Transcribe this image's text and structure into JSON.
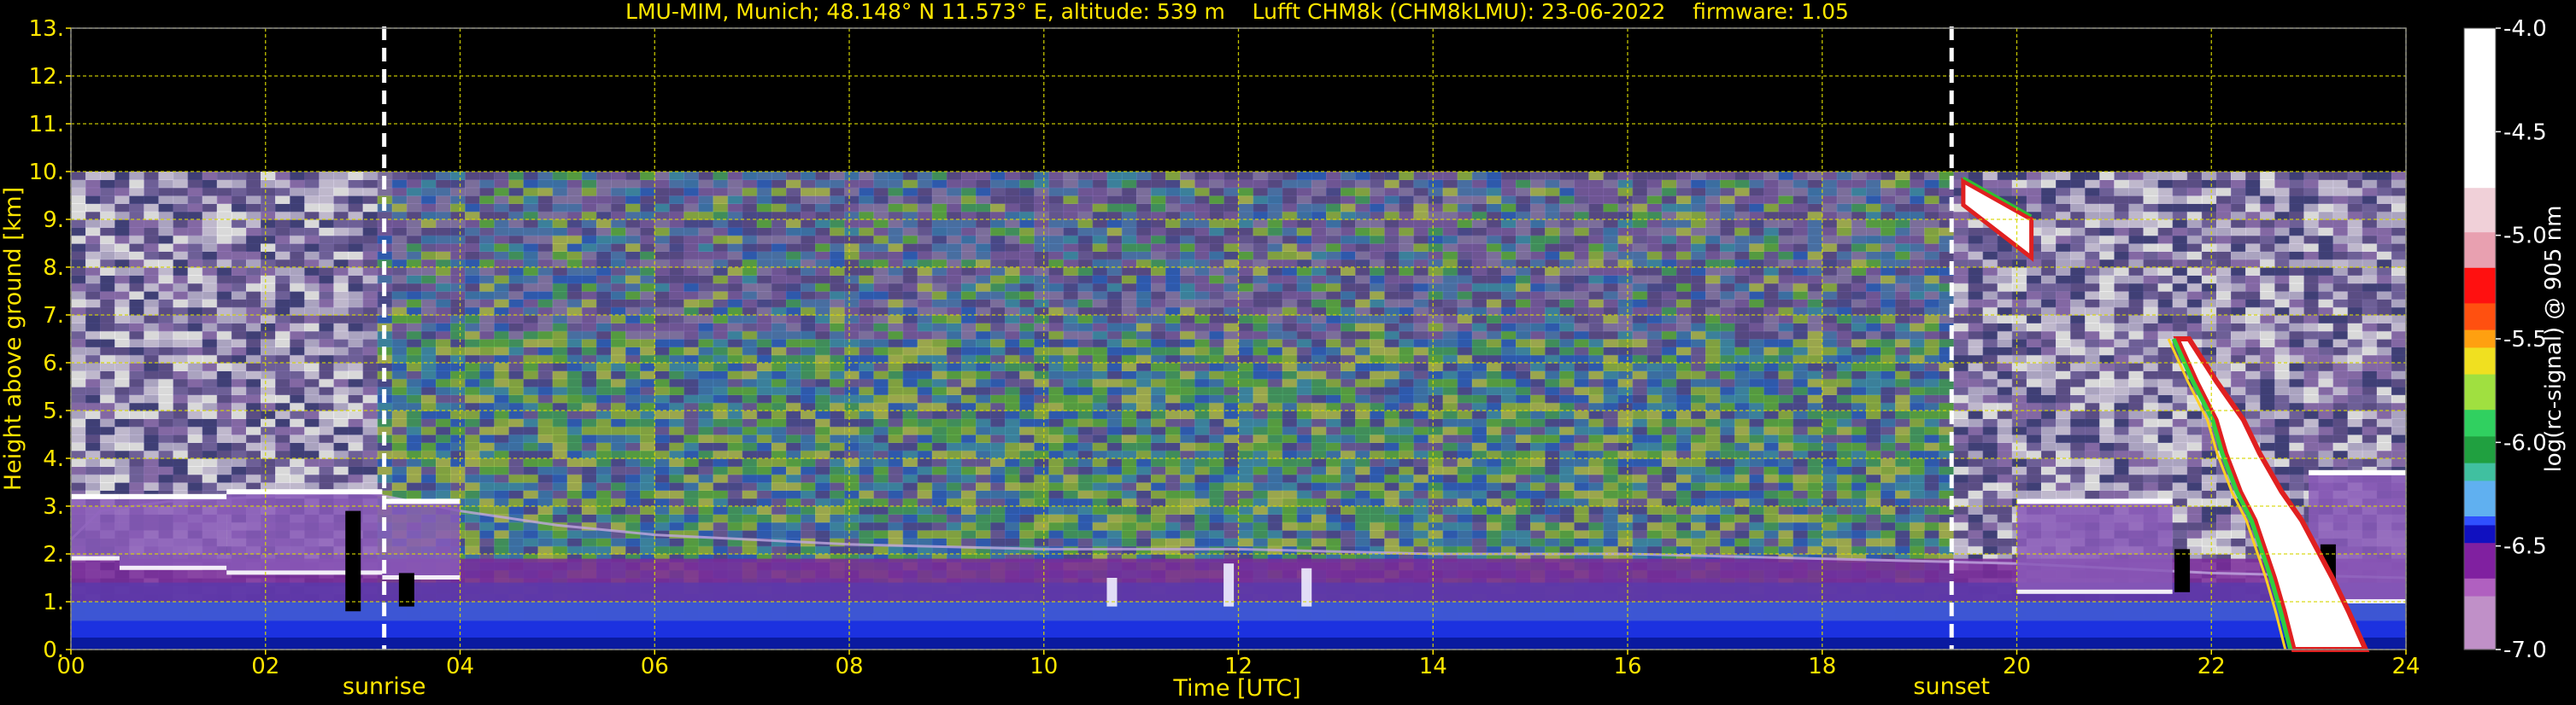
{
  "chart_data": {
    "type": "heatmap",
    "title": "LMU-MIM, Munich; 48.148° N 11.573° E, altitude: 539 m    Lufft CHM8k (CHM8kLMU): 23-06-2022    firmware: 1.05",
    "xlabel": "Time [UTC]",
    "ylabel": "Height above ground [km]",
    "xlim": [
      0,
      24
    ],
    "ylim": [
      0,
      13
    ],
    "x_ticks": [
      0,
      2,
      4,
      6,
      8,
      10,
      12,
      14,
      16,
      18,
      20,
      22,
      24
    ],
    "x_tick_labels": [
      "00",
      "02",
      "04",
      "06",
      "08",
      "10",
      "12",
      "14",
      "16",
      "18",
      "20",
      "22",
      "24"
    ],
    "y_ticks": [
      0,
      1,
      2,
      3,
      4,
      5,
      6,
      7,
      8,
      9,
      10,
      11,
      12,
      13
    ],
    "y_tick_labels": [
      "0.",
      "1.",
      "2.",
      "3.",
      "4.",
      "5.",
      "6.",
      "7.",
      "8.",
      "9.",
      "10.",
      "11.",
      "12.",
      "13."
    ],
    "grid": true,
    "data_top_km": 10,
    "sunrise": {
      "x": 3.22,
      "label": "sunrise"
    },
    "sunset": {
      "x": 19.33,
      "label": "sunset"
    },
    "colorbar": {
      "label": "log(rc-signal) @ 905 nm",
      "min": -7.0,
      "max": -4.0,
      "ticks": [
        -4.0,
        -4.5,
        -5.0,
        -5.5,
        -6.0,
        -6.5,
        -7.0
      ],
      "tick_labels": [
        "-4.0",
        "-4.5",
        "-5.0",
        "-5.5",
        "-6.0",
        "-6.5",
        "-7.0"
      ]
    },
    "features": {
      "boundary_layer_top_km": [
        [
          0.0,
          2.3
        ],
        [
          0.3,
          2.9
        ],
        [
          1.0,
          3.1
        ],
        [
          2.0,
          3.2
        ],
        [
          3.0,
          3.3
        ],
        [
          4.0,
          2.9
        ],
        [
          5.0,
          2.6
        ],
        [
          6.0,
          2.4
        ],
        [
          7.0,
          2.3
        ],
        [
          8.0,
          2.2
        ],
        [
          10.0,
          2.1
        ],
        [
          12.0,
          2.1
        ],
        [
          14.0,
          2.0
        ],
        [
          16.0,
          2.0
        ],
        [
          18.0,
          1.9
        ],
        [
          20.0,
          1.8
        ],
        [
          22.0,
          1.6
        ],
        [
          24.0,
          1.5
        ]
      ],
      "residual_layer_segments": [
        {
          "x0": 0.0,
          "x1": 0.5,
          "bottom_km": 1.9,
          "top_km": 3.2
        },
        {
          "x0": 0.5,
          "x1": 1.6,
          "bottom_km": 1.7,
          "top_km": 3.2
        },
        {
          "x0": 1.6,
          "x1": 3.2,
          "bottom_km": 1.6,
          "top_km": 3.3
        },
        {
          "x0": 3.2,
          "x1": 4.0,
          "bottom_km": 1.5,
          "top_km": 3.1
        },
        {
          "x0": 20.0,
          "x1": 21.6,
          "bottom_km": 1.2,
          "top_km": 3.1
        },
        {
          "x0": 23.0,
          "x1": 24.0,
          "bottom_km": 1.0,
          "top_km": 3.7
        }
      ],
      "convective_plumes": [
        {
          "x": 10.7,
          "top_km": 1.5
        },
        {
          "x": 11.9,
          "top_km": 1.8
        },
        {
          "x": 12.7,
          "top_km": 1.7
        }
      ],
      "high_cloud": {
        "x0": 19.45,
        "x1": 20.15,
        "top_start_km": 9.8,
        "top_end_km": 9.0,
        "base_start_km": 9.3,
        "base_end_km": 8.2
      },
      "cloud_fall_streak": [
        [
          21.7,
          6.5
        ],
        [
          21.9,
          5.6
        ],
        [
          22.1,
          4.8
        ],
        [
          22.2,
          4.1
        ],
        [
          22.35,
          3.3
        ],
        [
          22.5,
          2.7
        ],
        [
          22.6,
          2.1
        ],
        [
          22.7,
          1.5
        ],
        [
          22.8,
          0.8
        ],
        [
          22.9,
          0.0
        ]
      ],
      "night_noise_ranges": [
        [
          0.0,
          3.2
        ],
        [
          19.33,
          24.0
        ]
      ],
      "clear_gap_columns": [
        {
          "x": 2.9,
          "bottom_km": 0.8,
          "top_km": 2.9
        },
        {
          "x": 3.45,
          "bottom_km": 0.9,
          "top_km": 1.6
        },
        {
          "x": 21.7,
          "bottom_km": 1.2,
          "top_km": 2.1
        },
        {
          "x": 23.2,
          "bottom_km": 1.0,
          "top_km": 2.2
        }
      ]
    }
  }
}
